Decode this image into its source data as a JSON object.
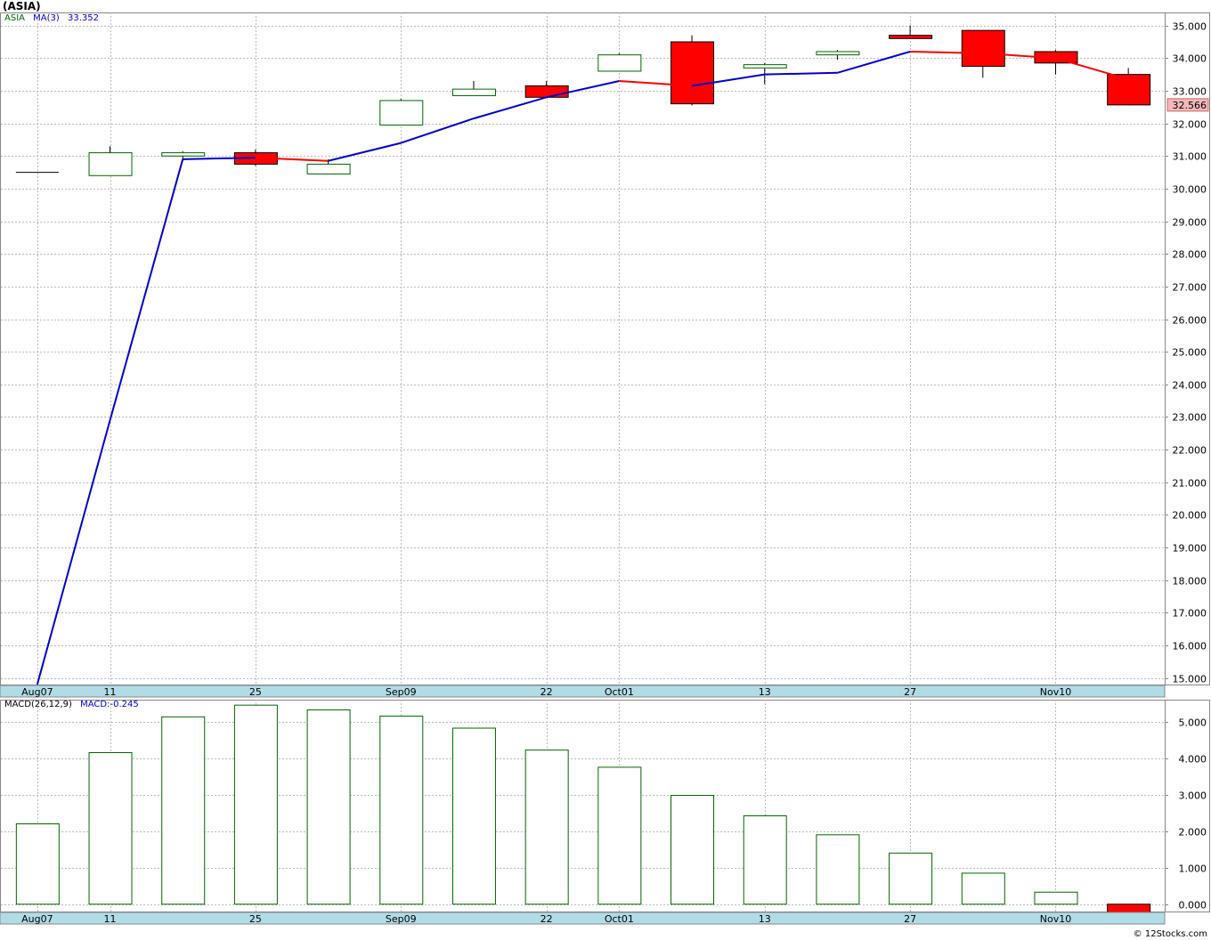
{
  "title": "(ASIA)",
  "watermark": "© 12Stocks.com",
  "colors": {
    "up": "#006600",
    "down": "#ff0000",
    "ma_up": "#0000cc",
    "ma_down": "#ff0000",
    "axis_band": "#b0dce6"
  },
  "price_legend": {
    "symbol": "ASIA",
    "indicator": "MA(3)",
    "value": "33.352"
  },
  "macd_legend": {
    "indicator": "MACD(26,12,9)",
    "value": "MACD:-0.245"
  },
  "last_price_label": "32.566",
  "x_axis_labels": [
    {
      "label": "Aug07",
      "index": 0
    },
    {
      "label": "11",
      "index": 1
    },
    {
      "label": "25",
      "index": 3
    },
    {
      "label": "Sep09",
      "index": 5
    },
    {
      "label": "22",
      "index": 7
    },
    {
      "label": "Oct01",
      "index": 8
    },
    {
      "label": "13",
      "index": 10
    },
    {
      "label": "27",
      "index": 12
    },
    {
      "label": "Nov10",
      "index": 14
    }
  ],
  "chart_data": [
    {
      "type": "candlestick",
      "title": "(ASIA)",
      "ylim": [
        14.8,
        35.4
      ],
      "y_ticks": [
        "15.000",
        "16.000",
        "17.000",
        "18.000",
        "19.000",
        "20.000",
        "21.000",
        "22.000",
        "23.000",
        "24.000",
        "25.000",
        "26.000",
        "27.000",
        "28.000",
        "29.000",
        "30.000",
        "31.000",
        "32.000",
        "33.000",
        "34.000",
        "35.000"
      ],
      "candles": [
        {
          "open": 30.5,
          "high": 30.5,
          "low": 30.5,
          "close": 30.5
        },
        {
          "open": 30.4,
          "high": 31.3,
          "low": 30.4,
          "close": 31.1
        },
        {
          "open": 31.0,
          "high": 31.15,
          "low": 30.85,
          "close": 31.1
        },
        {
          "open": 31.1,
          "high": 31.2,
          "low": 30.7,
          "close": 30.75
        },
        {
          "open": 30.45,
          "high": 30.9,
          "low": 30.45,
          "close": 30.75
        },
        {
          "open": 31.95,
          "high": 32.75,
          "low": 31.95,
          "close": 32.7
        },
        {
          "open": 32.85,
          "high": 33.3,
          "low": 32.85,
          "close": 33.05
        },
        {
          "open": 33.15,
          "high": 33.3,
          "low": 32.8,
          "close": 32.8
        },
        {
          "open": 33.6,
          "high": 34.15,
          "low": 33.6,
          "close": 34.1
        },
        {
          "open": 34.5,
          "high": 34.7,
          "low": 32.55,
          "close": 32.6
        },
        {
          "open": 33.7,
          "high": 33.85,
          "low": 33.2,
          "close": 33.8
        },
        {
          "open": 34.1,
          "high": 34.25,
          "low": 33.95,
          "close": 34.2
        },
        {
          "open": 34.7,
          "high": 35.0,
          "low": 34.6,
          "close": 34.6
        },
        {
          "open": 34.85,
          "high": 34.85,
          "low": 33.4,
          "close": 33.75
        },
        {
          "open": 34.2,
          "high": 34.25,
          "low": 33.5,
          "close": 33.85
        },
        {
          "open": 33.5,
          "high": 33.7,
          "low": 32.55,
          "close": 32.566
        }
      ],
      "ma3": [
        null,
        22.9,
        30.9,
        30.95,
        30.85,
        31.4,
        32.15,
        32.8,
        33.3,
        33.15,
        33.5,
        33.55,
        34.2,
        34.15,
        34.0,
        33.352
      ]
    },
    {
      "type": "bar",
      "title": "MACD(26,12,9)",
      "ylim": [
        -0.2,
        5.6
      ],
      "y_ticks": [
        "0.000",
        "1.000",
        "2.000",
        "3.000",
        "4.000",
        "5.000"
      ],
      "values": [
        2.2,
        4.15,
        5.13,
        5.45,
        5.32,
        5.15,
        4.82,
        4.22,
        3.75,
        2.98,
        2.42,
        1.9,
        1.4,
        0.85,
        0.33,
        -0.245
      ]
    }
  ]
}
